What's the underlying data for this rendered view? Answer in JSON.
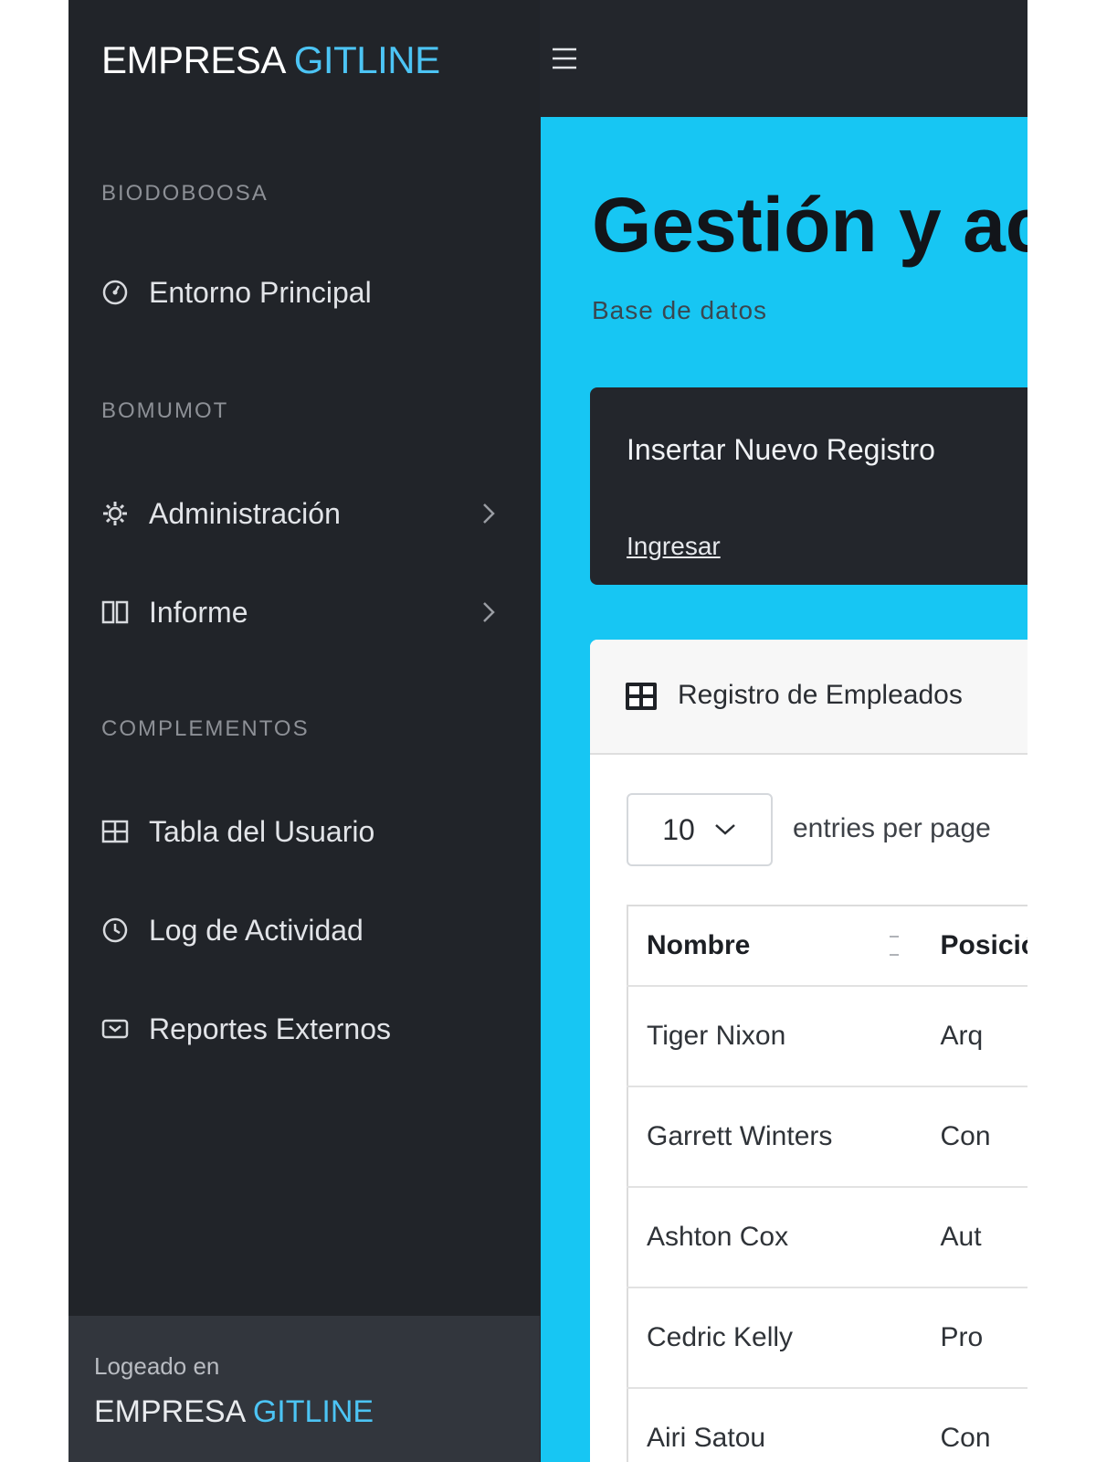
{
  "app": {
    "brand_main": "EMPRESA",
    "brand_accent": "GITLINE"
  },
  "colors": {
    "sidebar_bg": "#212429",
    "main_bg": "#17c6f3",
    "accent": "#4cc4f4",
    "card_dark": "#23262c"
  },
  "sidebar": {
    "sections": [
      {
        "heading": "BIODOBOOSA",
        "items": [
          {
            "label": "Entorno Principal",
            "icon": "dashboard-icon"
          }
        ]
      },
      {
        "heading": "BOMUMOT",
        "items": [
          {
            "label": "Administración",
            "icon": "gear-icon",
            "has_submenu": true
          },
          {
            "label": "Informe",
            "icon": "columns-icon",
            "has_submenu": true
          }
        ]
      },
      {
        "heading": "COMPLEMENTOS",
        "items": [
          {
            "label": "Tabla del Usuario",
            "icon": "table-icon"
          },
          {
            "label": "Log de Actividad",
            "icon": "clock-icon"
          },
          {
            "label": "Reportes Externos",
            "icon": "report-icon"
          }
        ]
      }
    ],
    "footer": {
      "label": "Logeado en",
      "brand_main": "EMPRESA",
      "brand_accent": "GITLINE"
    }
  },
  "main": {
    "title": "Gestión y ac",
    "subtitle": "Base de datos",
    "insert_card": {
      "title": "Insertar Nuevo Registro",
      "link": "Ingresar"
    },
    "table_card": {
      "title": "Registro de Empleados",
      "entries_value": "10",
      "entries_text": "entries per page",
      "columns": [
        "Nombre",
        "Posición"
      ],
      "rows": [
        [
          "Tiger Nixon",
          "Arq"
        ],
        [
          "Garrett Winters",
          "Con"
        ],
        [
          "Ashton Cox",
          "Aut"
        ],
        [
          "Cedric Kelly",
          "Pro"
        ],
        [
          "Airi Satou",
          "Con"
        ]
      ]
    }
  }
}
